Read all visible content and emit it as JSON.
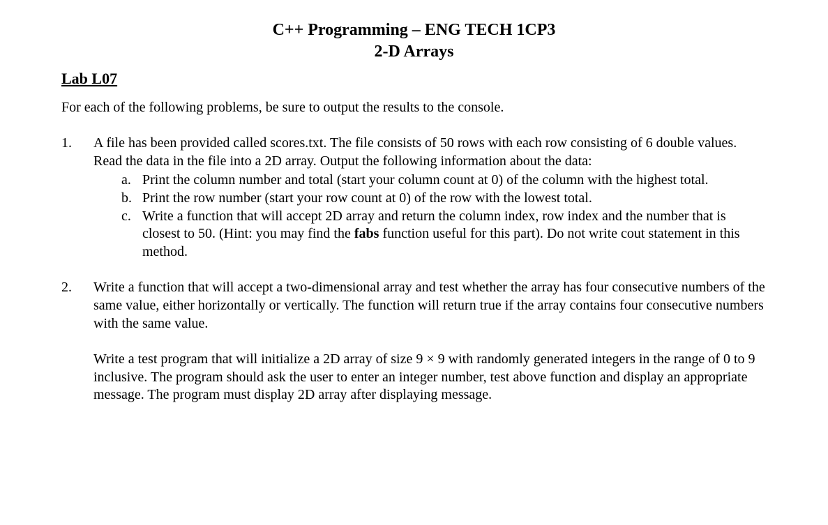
{
  "title": {
    "line1": "C++ Programming – ENG TECH 1CP3",
    "line2": "2-D Arrays"
  },
  "lab_heading": "Lab L07",
  "intro": "For each of the following problems, be sure to output the results to the console.",
  "problems": [
    {
      "number": "1.",
      "text": "A file has been provided called scores.txt.  The file consists of 50 rows with each row consisting of 6 double values.  Read the data in the file into a 2D array.  Output the following information about the data:",
      "subitems": [
        {
          "marker": "a.",
          "text": "Print the column number and total (start your column count at 0) of the column with the highest total."
        },
        {
          "marker": "b.",
          "text": "Print the row number (start your row count at 0) of the row with the lowest total."
        },
        {
          "marker": "c.",
          "text_before": "Write a function that will accept 2D array and return the column index, row index and the number that is closest to 50. (Hint: you may find the ",
          "bold_word": "fabs",
          "text_after": " function useful for this part). Do not write cout statement in this method."
        }
      ]
    },
    {
      "number": "2.",
      "para1": "Write a function that will accept a two-dimensional array and test whether the array has four consecutive numbers of the same value, either horizontally or vertically. The function will return true if the array contains four consecutive numbers with the same value.",
      "para2": "Write a test program that will initialize a 2D array of size 9 × 9 with randomly generated integers in the range of 0 to 9 inclusive.  The program should ask the user to enter an integer number, test above function and display an appropriate message. The program must display 2D array after displaying message."
    }
  ]
}
